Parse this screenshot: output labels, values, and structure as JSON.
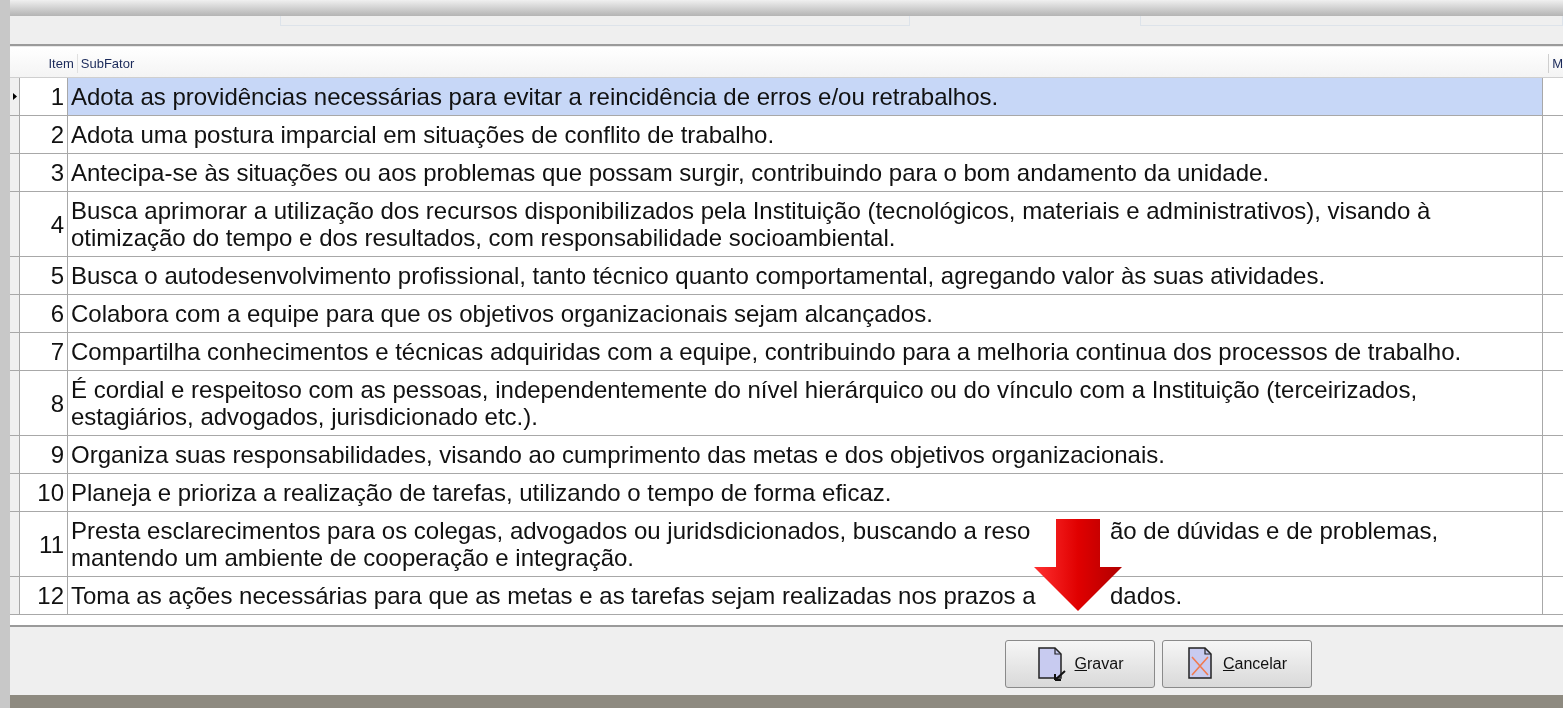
{
  "table": {
    "columns": [
      "Item",
      "SubFator",
      "M"
    ],
    "rows": [
      {
        "item": "1",
        "text": "Adota as providências necessárias para evitar a reincidência de erros e/ou retrabalhos.",
        "selected": true
      },
      {
        "item": "2",
        "text": "Adota uma postura imparcial em situações de conflito de trabalho.",
        "selected": false
      },
      {
        "item": "3",
        "text": "Antecipa-se às situações ou aos problemas que possam surgir, contribuindo para o bom andamento da unidade.",
        "selected": false
      },
      {
        "item": "4",
        "text": "Busca aprimorar a utilização dos recursos disponibilizados pela Instituição (tecnológicos, materiais e administrativos), visando à otimização do tempo e dos resultados, com responsabilidade socioambiental.",
        "selected": false
      },
      {
        "item": "5",
        "text": "Busca o autodesenvolvimento profissional, tanto técnico quanto comportamental, agregando valor às suas atividades.",
        "selected": false
      },
      {
        "item": "6",
        "text": "Colabora com a equipe para que os objetivos organizacionais sejam alcançados.",
        "selected": false
      },
      {
        "item": "7",
        "text": "Compartilha conhecimentos e técnicas adquiridas com a equipe, contribuindo para a melhoria continua dos processos de trabalho.",
        "selected": false
      },
      {
        "item": "8",
        "text": "É cordial e respeitoso com as pessoas, independentemente do nível hierárquico ou do vínculo com a Instituição (terceirizados, estagiários, advogados, jurisdicionado etc.).",
        "selected": false
      },
      {
        "item": "9",
        "text": "Organiza suas responsabilidades, visando ao cumprimento das metas e dos objetivos organizacionais.",
        "selected": false
      },
      {
        "item": "10",
        "text": "Planeja e prioriza a realização de tarefas, utilizando o tempo de forma eficaz.",
        "selected": false
      },
      {
        "item": "11",
        "text_parts": [
          "Presta esclarecimentos para os colegas, advogados ou juridsdicionados, buscando a reso",
          "ão de dúvidas e de problemas,",
          "mantendo um ambiente de cooperação e integração."
        ],
        "selected": false
      },
      {
        "item": "12",
        "text_parts": [
          "Toma as ações necessárias para que as metas e as tarefas sejam realizadas nos prazos a",
          "dados."
        ],
        "selected": false
      }
    ]
  },
  "buttons": [
    {
      "label": "Gravar",
      "kind": "save"
    },
    {
      "label": "Cancelar",
      "kind": "cancel"
    }
  ]
}
